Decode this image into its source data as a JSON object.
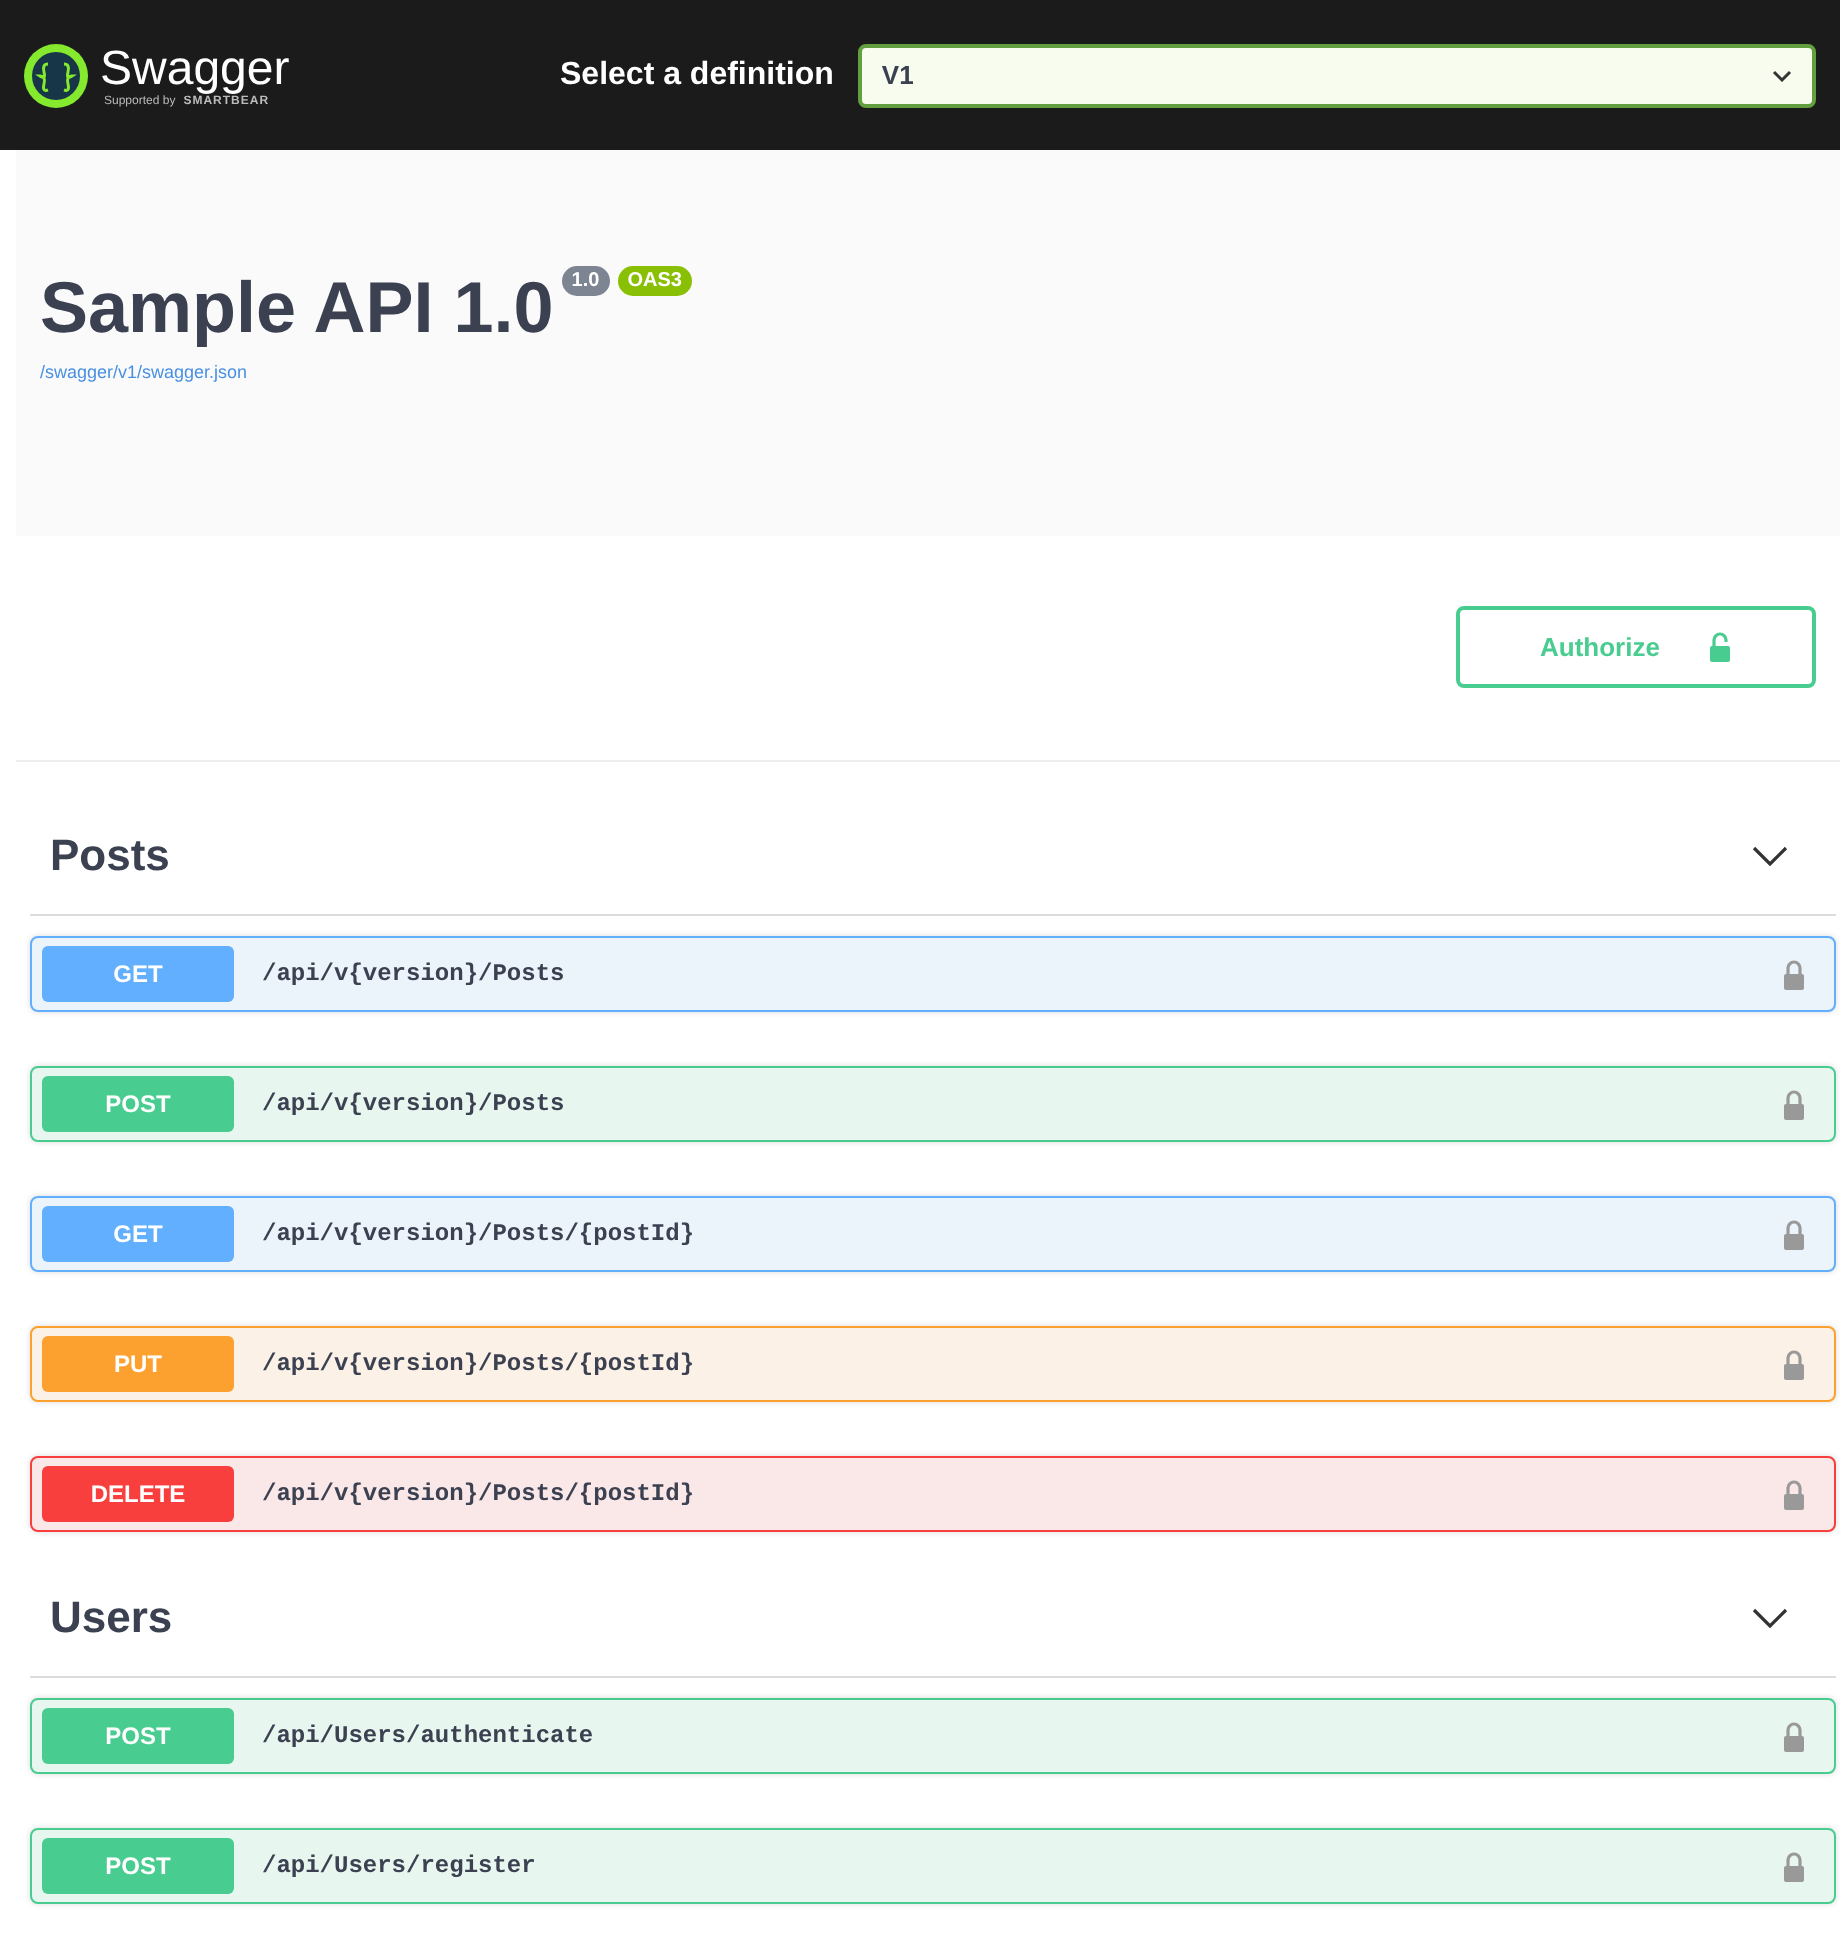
{
  "topbar": {
    "brand": "Swagger",
    "tagline_prefix": "Supported by",
    "tagline_brand": "SMARTBEAR",
    "select_label": "Select a definition",
    "select_value": "V1"
  },
  "info": {
    "title": "Sample API 1.0",
    "version_badge": "1.0",
    "oas_badge": "OAS3",
    "spec_link": "/swagger/v1/swagger.json"
  },
  "authorize": {
    "label": "Authorize"
  },
  "sections": [
    {
      "name": "Posts",
      "expanded": true,
      "operations": [
        {
          "method": "GET",
          "path": "/api/v{version}/Posts"
        },
        {
          "method": "POST",
          "path": "/api/v{version}/Posts"
        },
        {
          "method": "GET",
          "path": "/api/v{version}/Posts/{postId}"
        },
        {
          "method": "PUT",
          "path": "/api/v{version}/Posts/{postId}"
        },
        {
          "method": "DELETE",
          "path": "/api/v{version}/Posts/{postId}"
        }
      ]
    },
    {
      "name": "Users",
      "expanded": true,
      "operations": [
        {
          "method": "POST",
          "path": "/api/Users/authenticate"
        },
        {
          "method": "POST",
          "path": "/api/Users/register"
        }
      ]
    }
  ]
}
